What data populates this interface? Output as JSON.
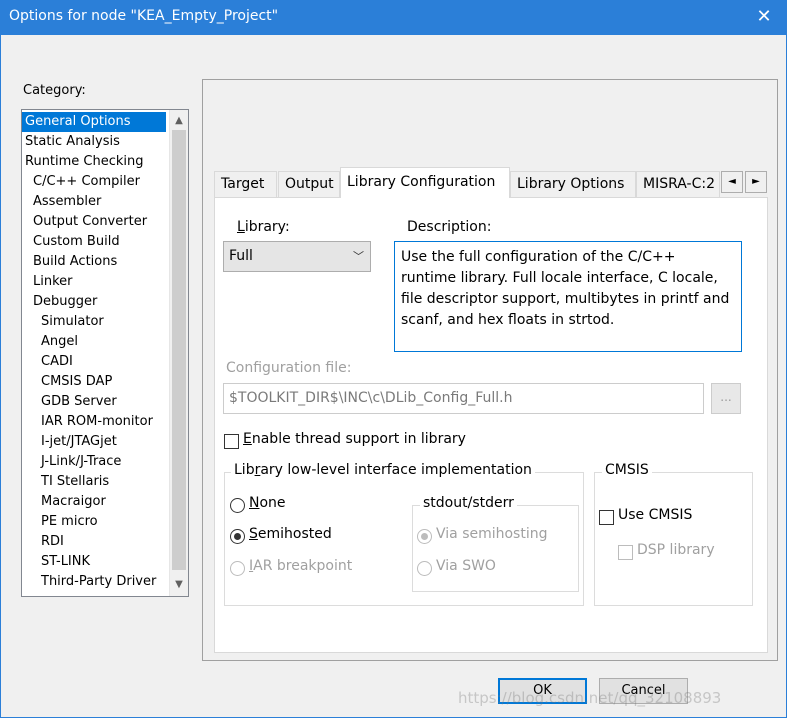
{
  "window": {
    "title": "Options for node \"KEA_Empty_Project\"",
    "close_glyph": "✕"
  },
  "category": {
    "label": "Category:",
    "items": [
      {
        "label": "General Options",
        "indent": 0,
        "selected": true
      },
      {
        "label": "Static Analysis",
        "indent": 0
      },
      {
        "label": "Runtime Checking",
        "indent": 0
      },
      {
        "label": "C/C++ Compiler",
        "indent": 1
      },
      {
        "label": "Assembler",
        "indent": 1
      },
      {
        "label": "Output Converter",
        "indent": 1
      },
      {
        "label": "Custom Build",
        "indent": 1
      },
      {
        "label": "Build Actions",
        "indent": 1
      },
      {
        "label": "Linker",
        "indent": 1
      },
      {
        "label": "Debugger",
        "indent": 1
      },
      {
        "label": "Simulator",
        "indent": 2
      },
      {
        "label": "Angel",
        "indent": 2
      },
      {
        "label": "CADI",
        "indent": 2
      },
      {
        "label": "CMSIS DAP",
        "indent": 2
      },
      {
        "label": "GDB Server",
        "indent": 2
      },
      {
        "label": "IAR ROM-monitor",
        "indent": 2
      },
      {
        "label": "I-jet/JTAGjet",
        "indent": 2
      },
      {
        "label": "J-Link/J-Trace",
        "indent": 2
      },
      {
        "label": "TI Stellaris",
        "indent": 2
      },
      {
        "label": "Macraigor",
        "indent": 2
      },
      {
        "label": "PE micro",
        "indent": 2
      },
      {
        "label": "RDI",
        "indent": 2
      },
      {
        "label": "ST-LINK",
        "indent": 2
      },
      {
        "label": "Third-Party Driver",
        "indent": 2
      }
    ]
  },
  "tabs": [
    {
      "label": "Target"
    },
    {
      "label": "Output"
    },
    {
      "label": "Library Configuration",
      "active": true
    },
    {
      "label": "Library Options"
    },
    {
      "label": "MISRA-C:2"
    }
  ],
  "library": {
    "label_pre": "",
    "label_u": "L",
    "label_post": "ibrary:",
    "selected": "Full",
    "description_label": "Description:",
    "description": "Use the full configuration of the C/C++ runtime library. Full locale interface, C locale, file descriptor support, multibytes in printf and scanf, and hex floats in strtod."
  },
  "config_file": {
    "label": "Configuration file:",
    "value": "$TOOLKIT_DIR$\\INC\\c\\DLib_Config_Full.h",
    "browse_label": "..."
  },
  "thread_support": {
    "label_u": "E",
    "label_rest": "nable thread support in library",
    "checked": false
  },
  "low_level": {
    "title_pre": "Library low-level interface implementation",
    "options": [
      {
        "u": "N",
        "rest": "one",
        "selected": false,
        "disabled": false
      },
      {
        "u": "S",
        "rest": "emihosted",
        "selected": true,
        "disabled": false
      },
      {
        "u": "I",
        "rest": "AR breakpoint",
        "selected": false,
        "disabled": true
      }
    ],
    "stdout": {
      "title": "stdout/stderr",
      "options": [
        {
          "label": "Via semihosting",
          "selected": true
        },
        {
          "label": "Via SWO",
          "selected": false
        }
      ]
    }
  },
  "cmsis": {
    "title": "CMSIS",
    "use_cmsis": "Use CMSIS",
    "dsp_library": "DSP library"
  },
  "buttons": {
    "ok": "OK",
    "cancel": "Cancel"
  },
  "watermark": "https://blog.csdn.net/qq_32108893"
}
